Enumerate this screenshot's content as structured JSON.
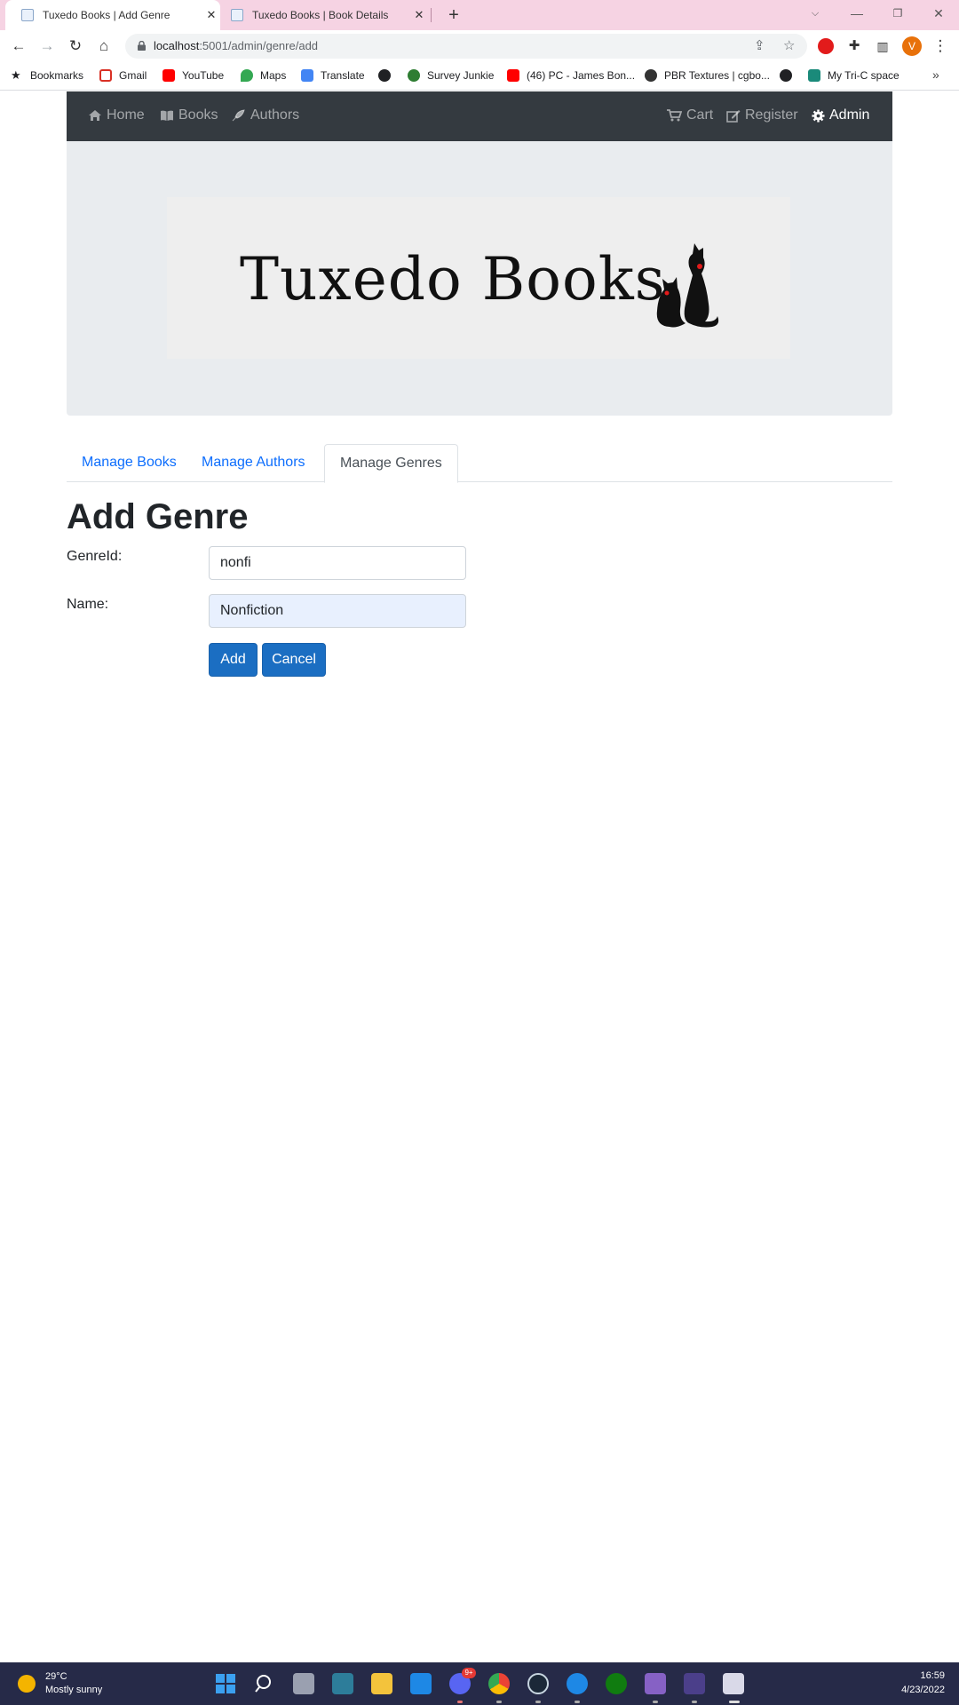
{
  "browser": {
    "tabs": [
      {
        "title": "Tuxedo Books | Add Genre",
        "active": true
      },
      {
        "title": "Tuxedo Books | Book Details",
        "active": false
      }
    ],
    "url_host": "localhost",
    "url_rest": ":5001/admin/genre/add",
    "avatar_letter": "V",
    "bookmarks": [
      {
        "label": "Bookmarks",
        "icon": "star-icon",
        "color": "#202124"
      },
      {
        "label": "Gmail",
        "icon": "gmail-icon",
        "color": "#d93025"
      },
      {
        "label": "YouTube",
        "icon": "youtube-icon",
        "color": "#ff0000"
      },
      {
        "label": "Maps",
        "icon": "maps-icon",
        "color": "#34a853"
      },
      {
        "label": "Translate",
        "icon": "translate-icon",
        "color": "#4285f4"
      },
      {
        "label": "",
        "icon": "globe-icon",
        "color": "#202124"
      },
      {
        "label": "Survey Junkie",
        "icon": "survey-junkie-icon",
        "color": "#2e7d32"
      },
      {
        "label": "(46) PC - James Bon...",
        "icon": "youtube-icon",
        "color": "#ff0000"
      },
      {
        "label": "PBR Textures | cgbo...",
        "icon": "palette-icon",
        "color": "#333333"
      },
      {
        "label": "",
        "icon": "globe-icon",
        "color": "#202124"
      },
      {
        "label": "My Tri-C space",
        "icon": "tri-c-icon",
        "color": "#1a8a7a"
      }
    ]
  },
  "navbar": {
    "left": [
      "Home",
      "Books",
      "Authors"
    ],
    "right": [
      "Cart",
      "Register",
      "Admin"
    ],
    "active": "Admin"
  },
  "logo": {
    "text": "Tuxedo Books"
  },
  "admin_tabs": [
    "Manage Books",
    "Manage Authors",
    "Manage Genres"
  ],
  "admin_tab_active": "Manage Genres",
  "form": {
    "heading": "Add Genre",
    "genre_id_label": "GenreId:",
    "genre_id_value": "nonfi",
    "name_label": "Name:",
    "name_value": "Nonfiction",
    "add_label": "Add",
    "cancel_label": "Cancel"
  },
  "taskbar": {
    "weather_temp": "29°C",
    "weather_desc": "Mostly sunny",
    "time": "16:59",
    "date": "4/23/2022",
    "discord_badge": "9+"
  },
  "colors": {
    "navbar_bg": "#343a40",
    "primary_button": "#1b6ec2",
    "tab_link": "#0d6efd",
    "tabstrip_bg": "#f6d3e3",
    "taskbar_bg": "#262a48"
  }
}
